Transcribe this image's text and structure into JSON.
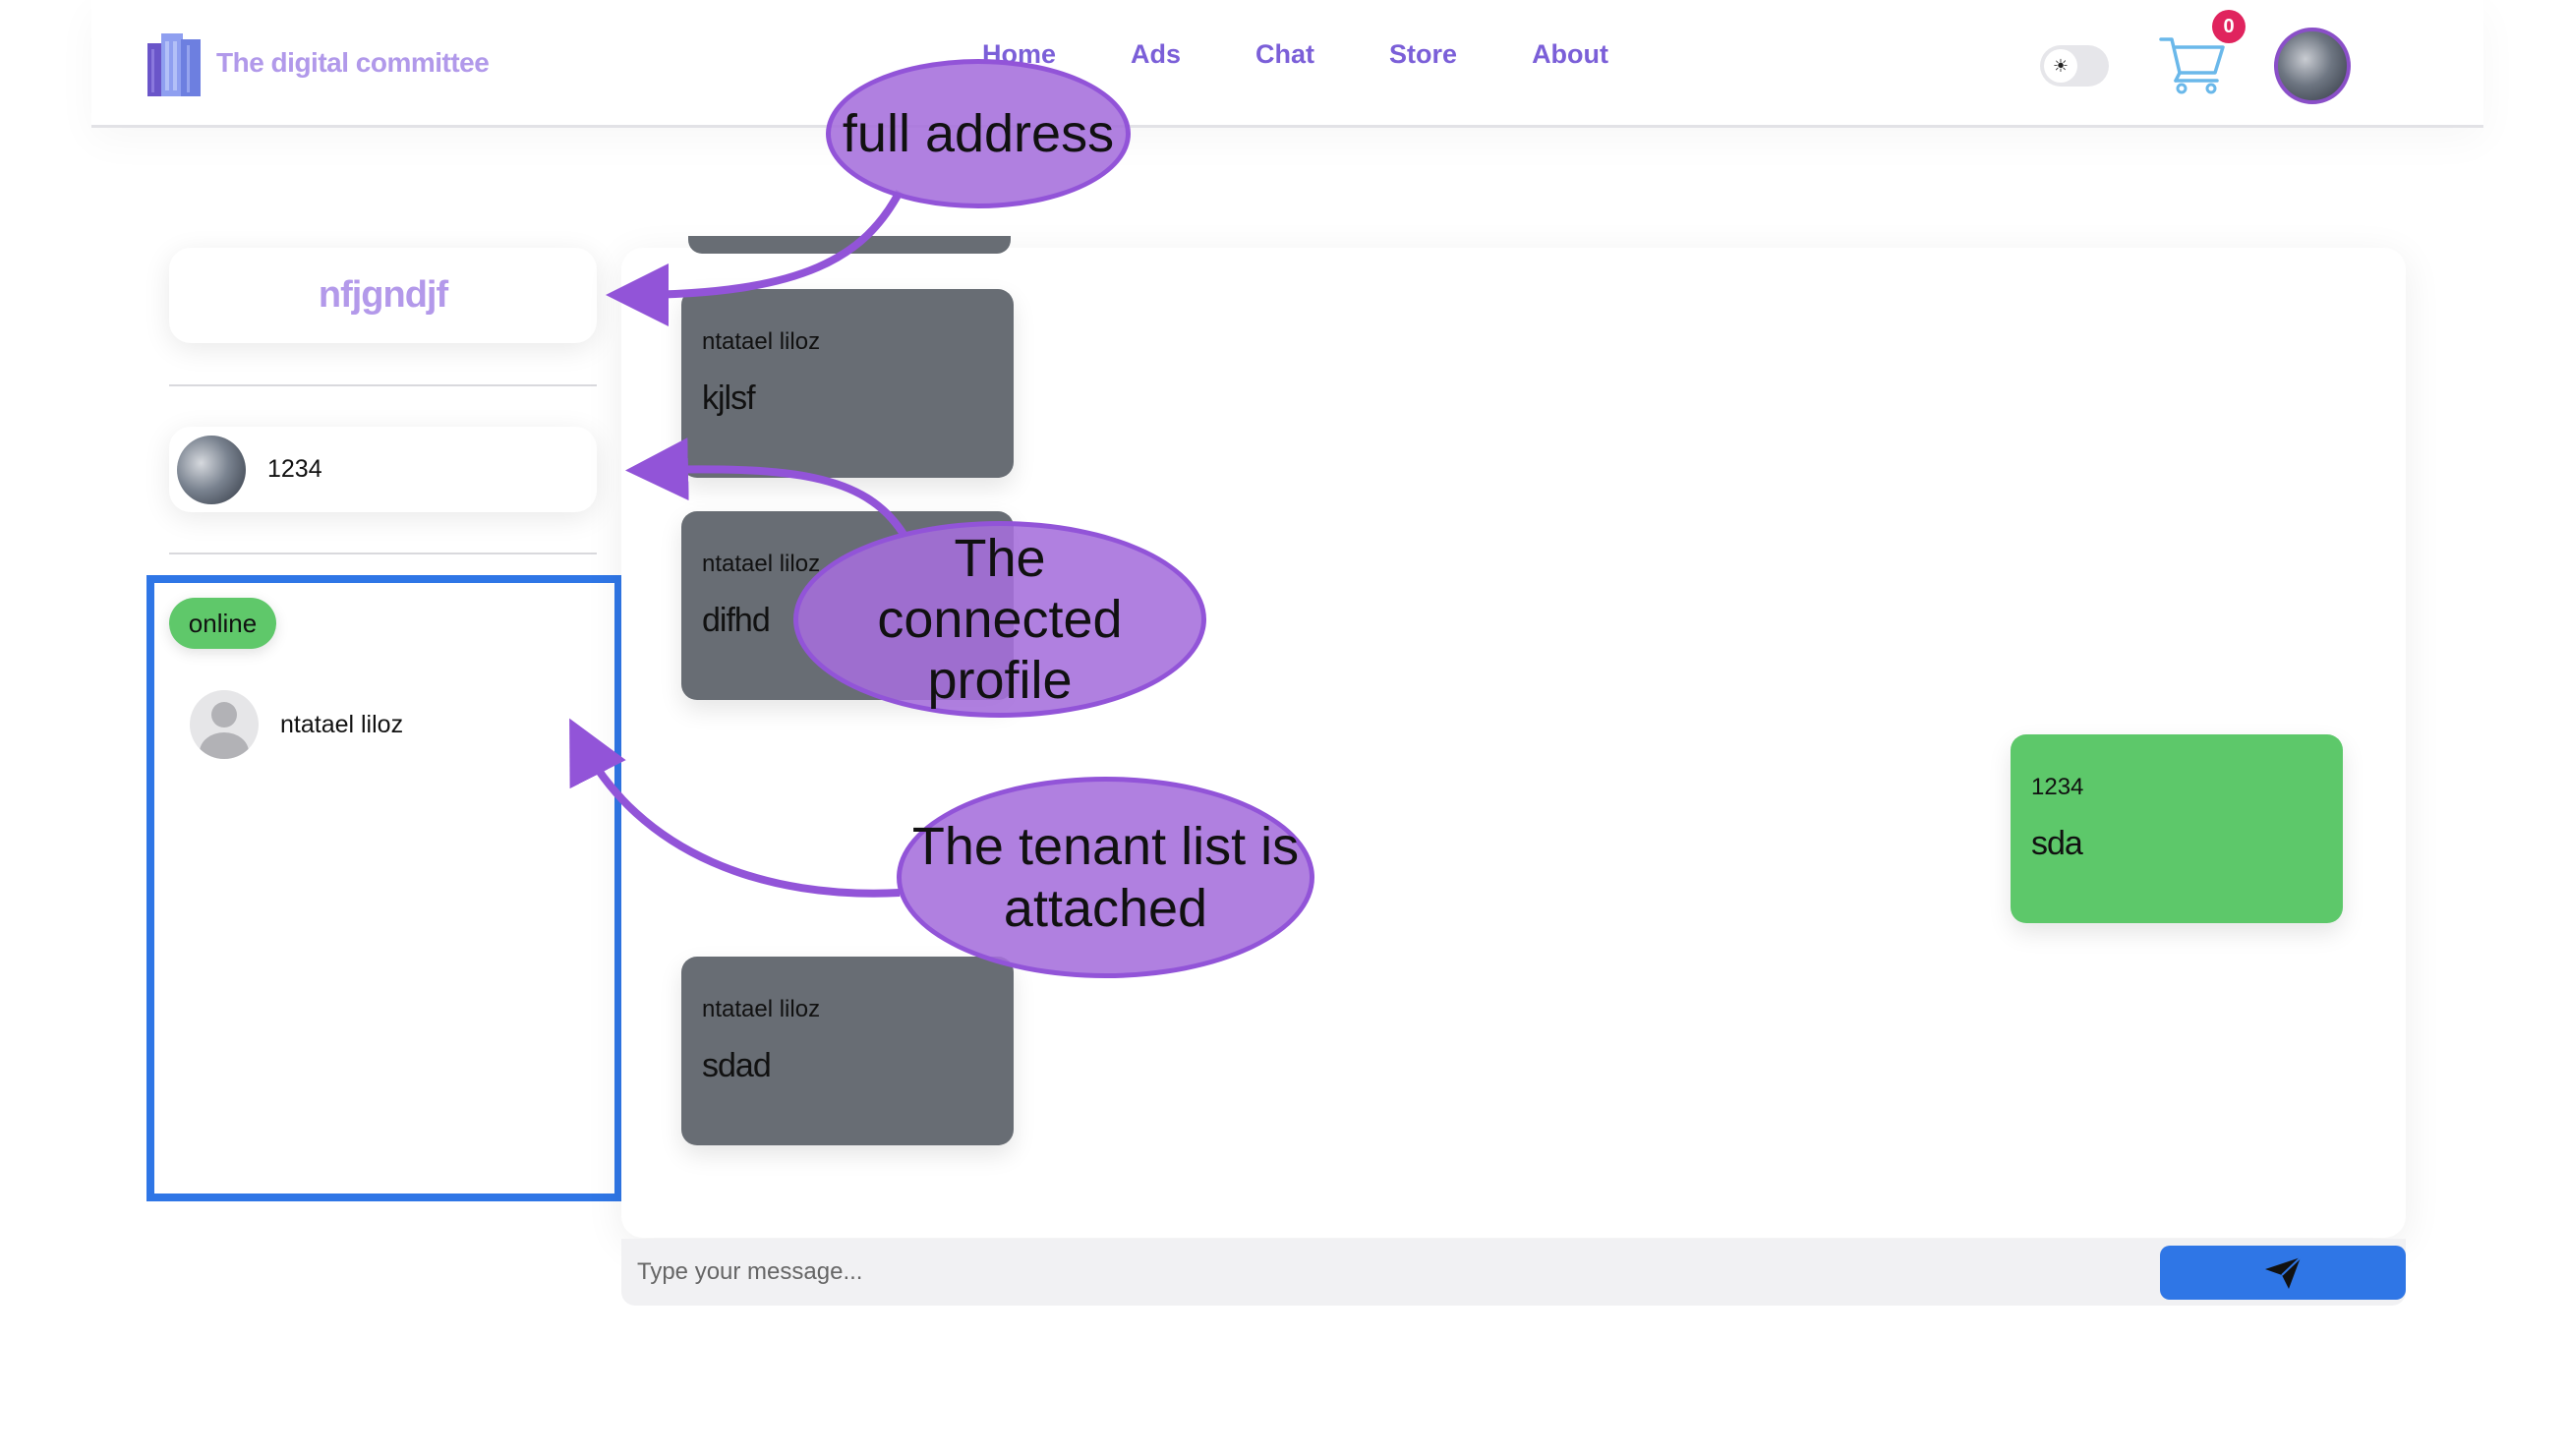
{
  "navbar": {
    "brand_name": "The digital committee",
    "links": [
      "Home",
      "Ads",
      "Chat",
      "Store",
      "About"
    ],
    "cart_count": "0",
    "theme_icon": "sun-icon"
  },
  "sidebar": {
    "address": "nfjgndjf",
    "profile_name": "1234",
    "online_label": "online",
    "tenants": [
      {
        "name": "ntatael liloz"
      }
    ]
  },
  "chat": {
    "messages": [
      {
        "sender": "ntatael liloz",
        "text": "kjlsf",
        "mine": false
      },
      {
        "sender": "ntatael liloz",
        "text": "difhd",
        "mine": false
      },
      {
        "sender": "1234",
        "text": "sda",
        "mine": true
      },
      {
        "sender": "ntatael liloz",
        "text": "sdad",
        "mine": false
      }
    ],
    "input_placeholder": "Type your message...",
    "send_icon": "send-icon"
  },
  "annotations": {
    "full_address": "full address",
    "connected_profile": "The connected profile",
    "tenant_list": "The tenant list is attached"
  },
  "colors": {
    "brand": "#b199ea",
    "nav_link": "#7b5fd8",
    "online": "#5fc86a",
    "message_other": "#686d74",
    "message_mine": "#5dc86a",
    "send_button": "#2f76e6",
    "annotation_fill": "#a56edc",
    "annotation_arrow": "#9254d8",
    "tenant_box_border": "#2f76e6"
  }
}
